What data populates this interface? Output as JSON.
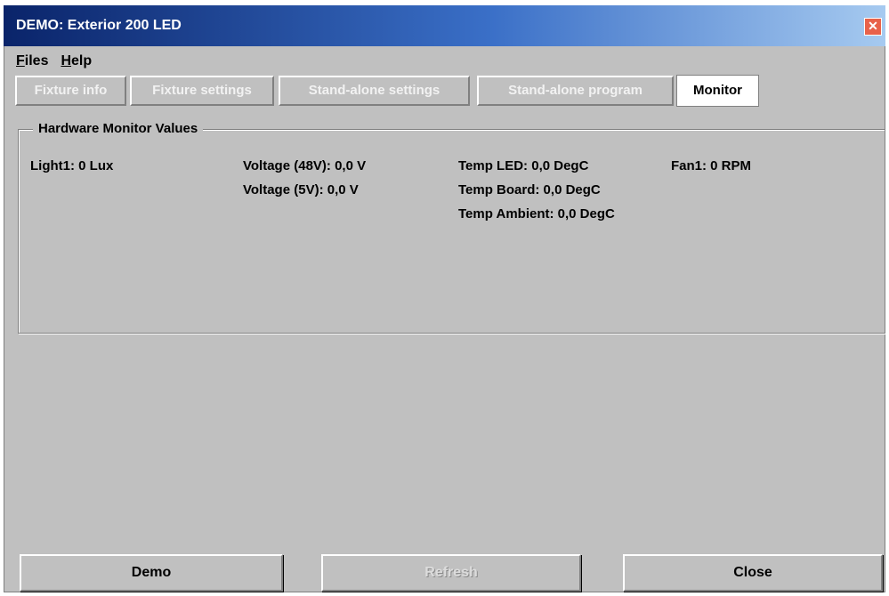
{
  "window": {
    "title": "DEMO: Exterior 200 LED",
    "close_glyph": "✕"
  },
  "menu": [
    {
      "accel": "F",
      "rest": "iles"
    },
    {
      "accel": "H",
      "rest": "elp"
    }
  ],
  "tabs": [
    {
      "label": "Fixture info",
      "active": false
    },
    {
      "label": "Fixture settings",
      "active": false
    },
    {
      "label": "Stand-alone settings",
      "active": false
    },
    {
      "label": "Stand-alone program",
      "active": false
    },
    {
      "label": "Monitor",
      "active": true
    }
  ],
  "monitor": {
    "group_title": "Hardware Monitor Values",
    "light1": "Light1: 0 Lux",
    "voltage48": "Voltage (48V): 0,0 V",
    "voltage5": "Voltage (5V): 0,0 V",
    "temp_led": "Temp LED: 0,0 DegC",
    "temp_board": "Temp Board: 0,0 DegC",
    "temp_ambient": "Temp Ambient: 0,0 DegC",
    "fan1": "Fan1: 0 RPM"
  },
  "buttons": {
    "demo": "Demo",
    "refresh": "Refresh",
    "close": "Close",
    "refresh_enabled": false
  },
  "colors": {
    "titlebar_start": "#0a246a",
    "titlebar_end": "#a6caf0",
    "face": "#c0c0c0",
    "close_button": "#e8624a"
  }
}
